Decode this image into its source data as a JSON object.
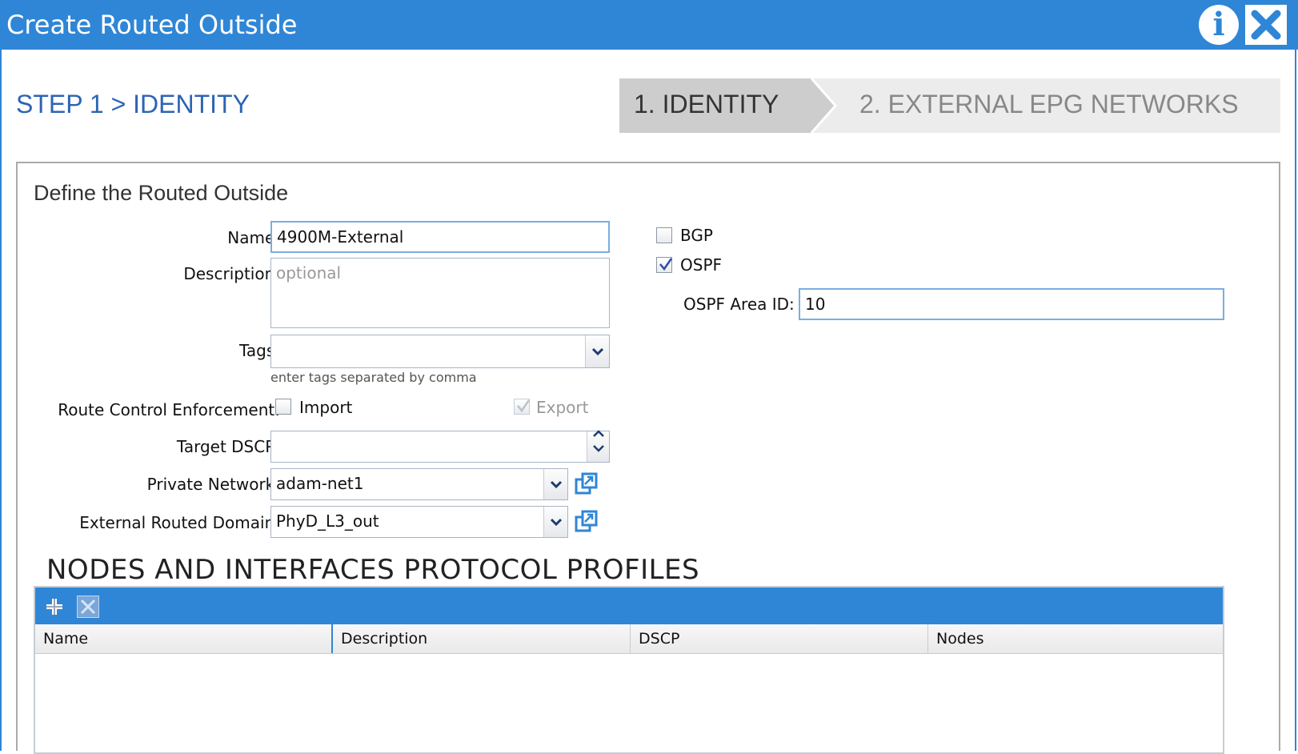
{
  "window": {
    "title": "Create Routed Outside",
    "info_label": "i"
  },
  "wizard": {
    "step_title": "STEP 1 > IDENTITY",
    "steps": [
      {
        "label": "1. IDENTITY",
        "active": true
      },
      {
        "label": "2. EXTERNAL EPG NETWORKS",
        "active": false
      }
    ]
  },
  "panel": {
    "heading": "Define the Routed Outside"
  },
  "form": {
    "name": {
      "label": "Name:",
      "value": "4900M-External"
    },
    "description": {
      "label": "Description:",
      "placeholder": "optional"
    },
    "tags": {
      "label": "Tags:",
      "value": "",
      "hint": "enter tags separated by comma"
    },
    "route_control": {
      "label": "Route Control Enforcement:",
      "import": {
        "label": "Import",
        "checked": false
      },
      "export": {
        "label": "Export",
        "checked": true,
        "disabled": true
      }
    },
    "target_dscp": {
      "label": "Target DSCP:",
      "value": ""
    },
    "private_network": {
      "label": "Private Network:",
      "value": "adam-net1"
    },
    "external_routed_domain": {
      "label": "External Routed Domain:",
      "value": "PhyD_L3_out"
    }
  },
  "protocols": {
    "bgp": {
      "label": "BGP",
      "checked": false
    },
    "ospf": {
      "label": "OSPF",
      "checked": true
    },
    "ospf_area_id": {
      "label": "OSPF Area ID:",
      "value": "10"
    }
  },
  "profiles_table": {
    "heading": "NODES AND INTERFACES PROTOCOL PROFILES",
    "columns": [
      "Name",
      "Description",
      "DSCP",
      "Nodes"
    ],
    "rows": []
  },
  "colors": {
    "accent": "#2f86d6",
    "step_title": "#2c64b4",
    "active_step_bg": "#cdcdcd",
    "inactive_step_bg": "#ececec"
  }
}
